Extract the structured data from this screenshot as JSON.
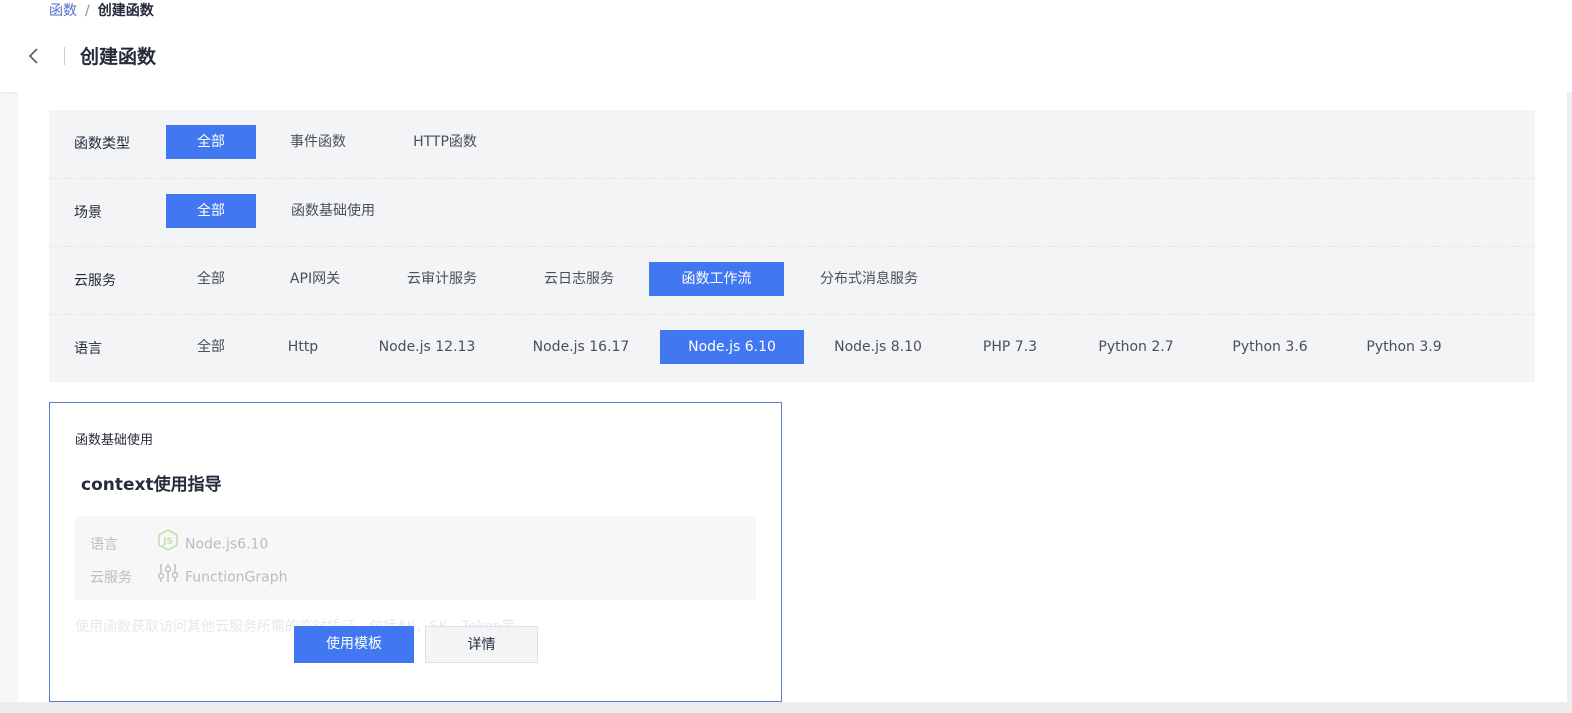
{
  "breadcrumb": {
    "parent": "函数",
    "separator": "/",
    "current": "创建函数"
  },
  "page": {
    "title": "创建函数"
  },
  "filters": {
    "function_type": {
      "label": "函数类型",
      "options": [
        "全部",
        "事件函数",
        "HTTP函数"
      ],
      "selected": "全部"
    },
    "scene": {
      "label": "场景",
      "options": [
        "全部",
        "函数基础使用"
      ],
      "selected": "全部"
    },
    "cloud_service": {
      "label": "云服务",
      "options": [
        "全部",
        "API网关",
        "云审计服务",
        "云日志服务",
        "函数工作流",
        "分布式消息服务"
      ],
      "selected": "函数工作流"
    },
    "language": {
      "label": "语言",
      "options": [
        "全部",
        "Http",
        "Node.js 12.13",
        "Node.js 16.17",
        "Node.js 6.10",
        "Node.js 8.10",
        "PHP 7.3",
        "Python 2.7",
        "Python 3.6",
        "Python 3.9"
      ],
      "selected": "Node.js 6.10"
    }
  },
  "card": {
    "category": "函数基础使用",
    "title": "context使用指导",
    "language_label": "语言",
    "language_value": "Node.js6.10",
    "language_icon": "nodejs-icon",
    "service_label": "云服务",
    "service_value": "FunctionGraph",
    "service_icon": "functiongraph-icon",
    "description": "使用函数获取访问其他云服务所需的临时凭证，包括AK、SK、Token等。",
    "use_template_label": "使用模板",
    "details_label": "详情"
  },
  "colors": {
    "primary": "#4177f0",
    "link": "#526ecc",
    "card_border": "#5e7ce0"
  }
}
